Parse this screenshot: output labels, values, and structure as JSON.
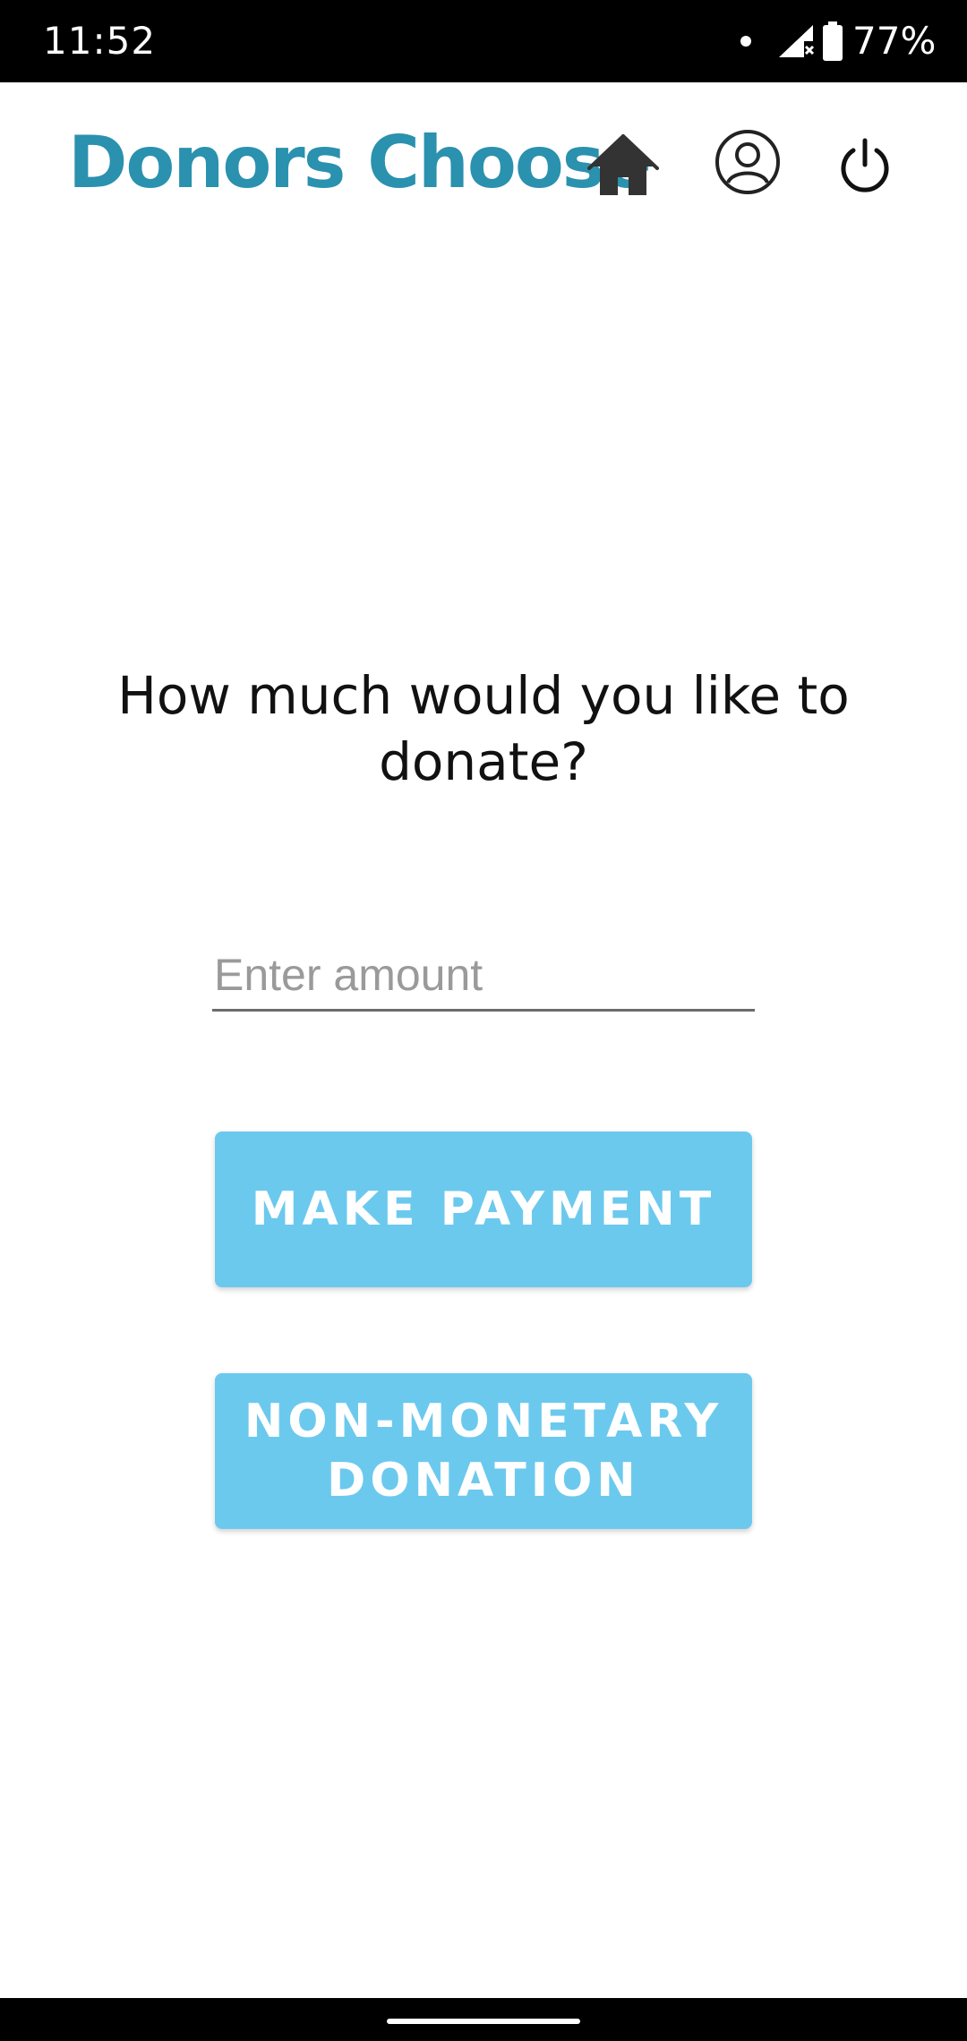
{
  "status_bar": {
    "time": "11:52",
    "battery_percent": "77%",
    "icons": [
      "notification-dot-icon",
      "signal-no-data-icon",
      "battery-icon"
    ]
  },
  "header": {
    "title": "Donors Choose",
    "title_color": "#2a91ae",
    "icons": [
      "home-icon",
      "profile-icon",
      "power-icon"
    ]
  },
  "main": {
    "question": "How much would you like to donate?",
    "amount_input": {
      "placeholder": "Enter amount",
      "value": ""
    },
    "buttons": {
      "make_payment": "MAKE PAYMENT",
      "non_monetary": "NON-MONETARY DONATION"
    },
    "button_color": "#6cc9ee"
  }
}
